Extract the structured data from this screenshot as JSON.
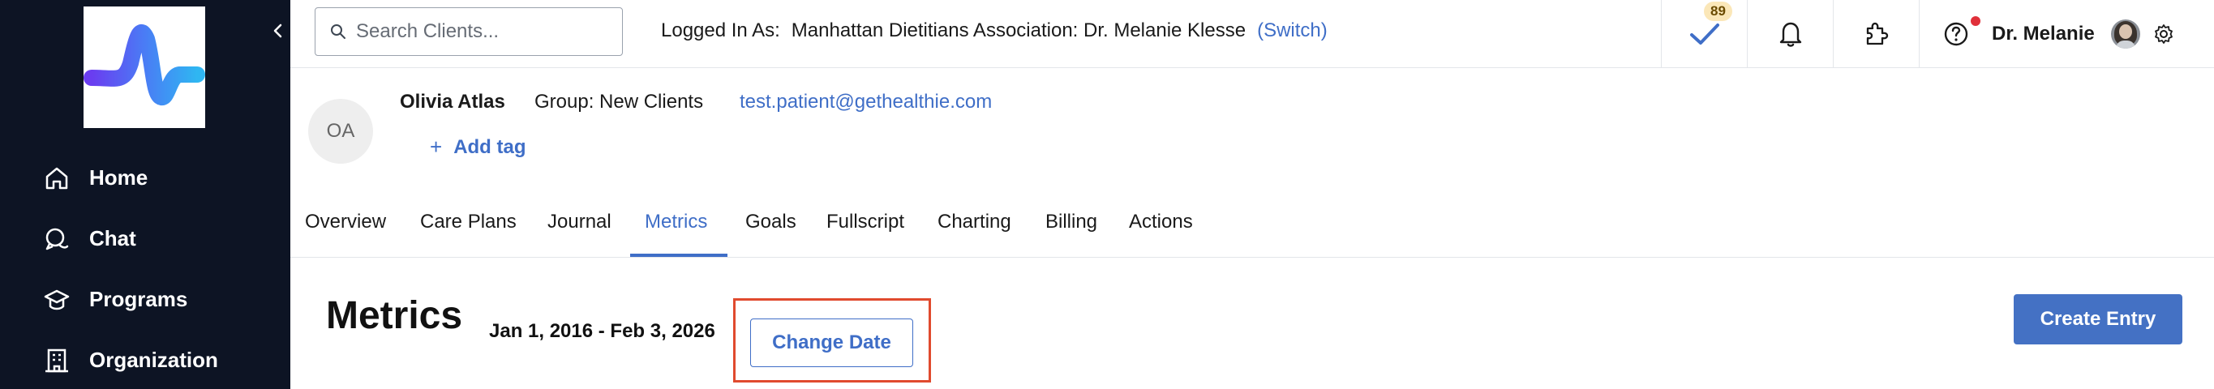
{
  "sidebar": {
    "items": [
      {
        "label": "Home",
        "icon": "home-icon"
      },
      {
        "label": "Chat",
        "icon": "chat-icon"
      },
      {
        "label": "Programs",
        "icon": "graduation-cap-icon"
      },
      {
        "label": "Organization",
        "icon": "building-icon"
      }
    ]
  },
  "topbar": {
    "search_placeholder": "Search Clients...",
    "logged_in_label": "Logged In As:",
    "organization": "Manhattan Dietitians Association: Dr. Melanie Klesse",
    "switch_label": "(Switch)",
    "tasks_count": "89",
    "user_name": "Dr. Melanie"
  },
  "client": {
    "initials": "OA",
    "name": "Olivia Atlas",
    "group": "Group: New Clients",
    "email": "test.patient@gethealthie.com",
    "add_tag": "Add tag"
  },
  "tabs": [
    {
      "label": "Overview"
    },
    {
      "label": "Care Plans"
    },
    {
      "label": "Journal"
    },
    {
      "label": "Metrics",
      "active": true
    },
    {
      "label": "Goals"
    },
    {
      "label": "Fullscript"
    },
    {
      "label": "Charting"
    },
    {
      "label": "Billing"
    },
    {
      "label": "Actions"
    }
  ],
  "metrics": {
    "title": "Metrics",
    "date_range": "Jan 1, 2016 - Feb 3, 2026",
    "change_date_label": "Change Date",
    "create_entry_label": "Create Entry"
  },
  "colors": {
    "sidebar_bg": "#0d1424",
    "accent": "#3f6ec7",
    "primary_button": "#4471c4",
    "highlight_border": "#e04a2e"
  }
}
